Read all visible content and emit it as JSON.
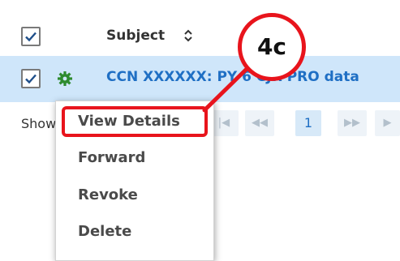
{
  "table": {
    "header": {
      "subject_label": "Subject"
    },
    "selected_row": {
      "subject": "CCN XXXXXX: PY 6 CJR PRO data"
    }
  },
  "pager": {
    "show_label": "Show",
    "first": "|◀",
    "prev": "◀◀",
    "current_page": "1",
    "next": "▶▶",
    "last": "▶"
  },
  "menu": {
    "items": [
      {
        "label": "View Details"
      },
      {
        "label": "Forward"
      },
      {
        "label": "Revoke"
      },
      {
        "label": "Delete"
      }
    ]
  },
  "callout": {
    "label": "4c"
  },
  "icons": {
    "sort": "sort-icon",
    "gear": "gear-icon",
    "check": "check-icon"
  },
  "colors": {
    "selected_row": "#cfe6fa",
    "link": "#1f6fc4",
    "gear": "#2e8b2e",
    "callout": "#e8141c"
  }
}
